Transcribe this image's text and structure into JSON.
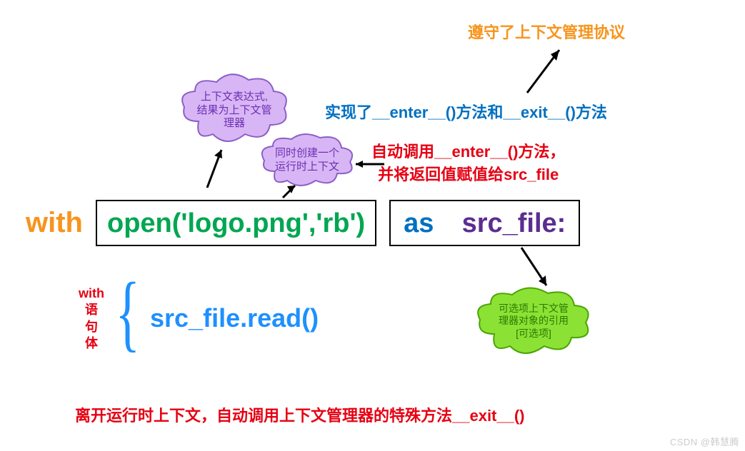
{
  "top_orange": "遵守了上下文管理协议",
  "blue_line": "实现了__enter__()方法和__exit__()方法",
  "red_line1": "自动调用__enter__()方法，",
  "red_line2": "并将返回值赋值给src_file",
  "cloud_purple1_l1": "上下文表达式,",
  "cloud_purple1_l2": "结果为上下文管",
  "cloud_purple1_l3": "理器",
  "cloud_purple2_l1": "同时创建一个",
  "cloud_purple2_l2": "运行时上下文",
  "code_with": "with",
  "code_open": "open('logo.png','rb')",
  "code_as": "as",
  "code_srcfile": "src_file:",
  "with_body_l1": "with",
  "with_body_l2": "语",
  "with_body_l3": "句",
  "with_body_l4": "体",
  "code_read": "src_file.read()",
  "cloud_green_l1": "可选项上下文管",
  "cloud_green_l2": "理器对象的引用",
  "cloud_green_l3": "[可选项]",
  "bottom_red": "离开运行时上下文，自动调用上下文管理器的特殊方法__exit__()",
  "watermark": "CSDN @韩慧腾"
}
